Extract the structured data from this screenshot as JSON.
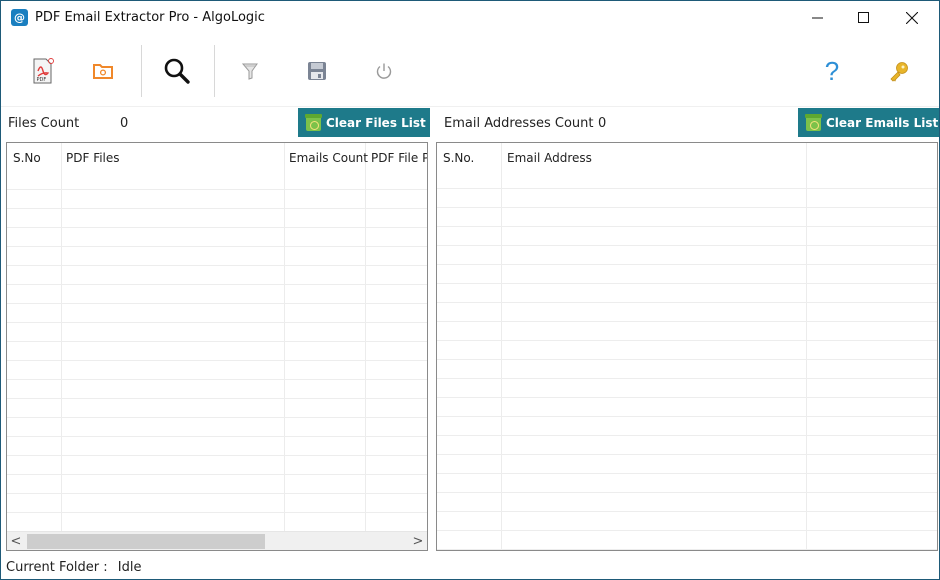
{
  "window": {
    "title": "PDF Email Extractor Pro - AlgoLogic",
    "app_icon_glyph": "@",
    "controls": {
      "minimize_glyph": "—",
      "maximize_glyph": "☐",
      "close_glyph": "✕"
    }
  },
  "toolbar": {
    "buttons": [
      {
        "name": "add-pdf",
        "icon": "pdf-file-icon",
        "tooltip": ""
      },
      {
        "name": "add-folder",
        "icon": "folder-icon",
        "tooltip": ""
      },
      {
        "name": "search",
        "icon": "search-icon",
        "tooltip": ""
      },
      {
        "name": "filter",
        "icon": "filter-icon",
        "tooltip": ""
      },
      {
        "name": "save",
        "icon": "save-icon",
        "tooltip": ""
      },
      {
        "name": "power",
        "icon": "power-icon",
        "tooltip": ""
      },
      {
        "name": "help",
        "icon": "help-icon",
        "glyph": "?"
      },
      {
        "name": "license",
        "icon": "key-icon",
        "tooltip": ""
      }
    ]
  },
  "files_panel": {
    "count_label": "Files Count",
    "count_value": "0",
    "clear_button": "Clear Files List",
    "columns": [
      "S.No",
      "PDF Files",
      "Emails Count",
      "PDF File Pa"
    ],
    "rows": [],
    "scroll_left_glyph": "<",
    "scroll_right_glyph": ">"
  },
  "emails_panel": {
    "count_label": "Email Addresses Count",
    "count_value": "0",
    "clear_button": "Clear Emails List",
    "columns": [
      "S.No.",
      "Email Address",
      ""
    ],
    "rows": []
  },
  "status": {
    "label": "Current Folder :",
    "value": "Idle"
  },
  "colors": {
    "accent": "#1e7a8a",
    "window_border": "#1e5a78",
    "help_blue": "#2d8fd6",
    "key_gold": "#e8b52a",
    "folder_orange": "#f0882a"
  }
}
